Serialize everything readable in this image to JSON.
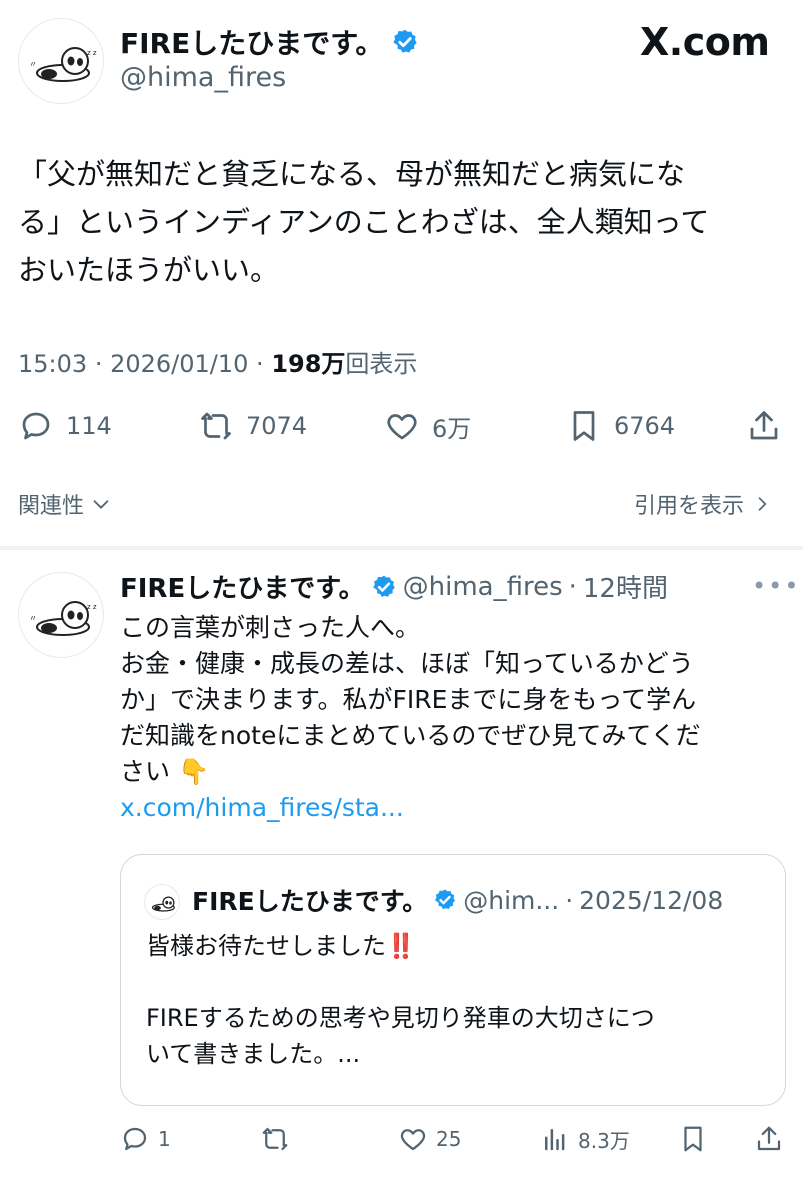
{
  "brand": {
    "logo_text": "X.com"
  },
  "main_post": {
    "author_name": "FIREしたひまです。",
    "handle": "@hima_fires",
    "text_lines": [
      "「父が無知だと貧乏になる、母が無知だと病気にな",
      "る」というインディアンのことわざは、全人類知って",
      "おいたほうがいい。"
    ],
    "time": "15:03",
    "date": "2026/01/10",
    "views_count": "198万",
    "views_label": "回表示",
    "stats": {
      "replies": "114",
      "reposts": "7074",
      "likes": "6万",
      "bookmarks": "6764"
    },
    "related_label": "関連性",
    "quotes_label": "引用を表示"
  },
  "reply": {
    "author_name": "FIREしたひまです。",
    "handle": "@hima_fires",
    "time_ago": "12時間",
    "text_lines": [
      "この言葉が刺さった人へ。",
      "お金・健康・成長の差は、ほぼ「知っているかどう",
      "か」で決まります。私がFIREまでに身をもって学ん",
      "だ知識をnoteにまとめているのでぜひ見てみてくだ",
      "さい 👇"
    ],
    "link_text": "x.com/hima_fires/sta...",
    "quoted": {
      "author_name": "FIREしたひまです。",
      "handle": "@him...",
      "date": "2025/12/08",
      "text_lines": [
        "皆様お待たせしました‼️",
        "",
        "FIREするための思考や見切り発車の大切さにつ",
        "いて書きました。..."
      ]
    },
    "stats": {
      "replies": "1",
      "reposts": "",
      "likes": "25",
      "views": "8.3万"
    }
  },
  "colors": {
    "accent": "#1d9bf0",
    "secondary_text": "#536471",
    "verified": "#1d9bf0"
  }
}
